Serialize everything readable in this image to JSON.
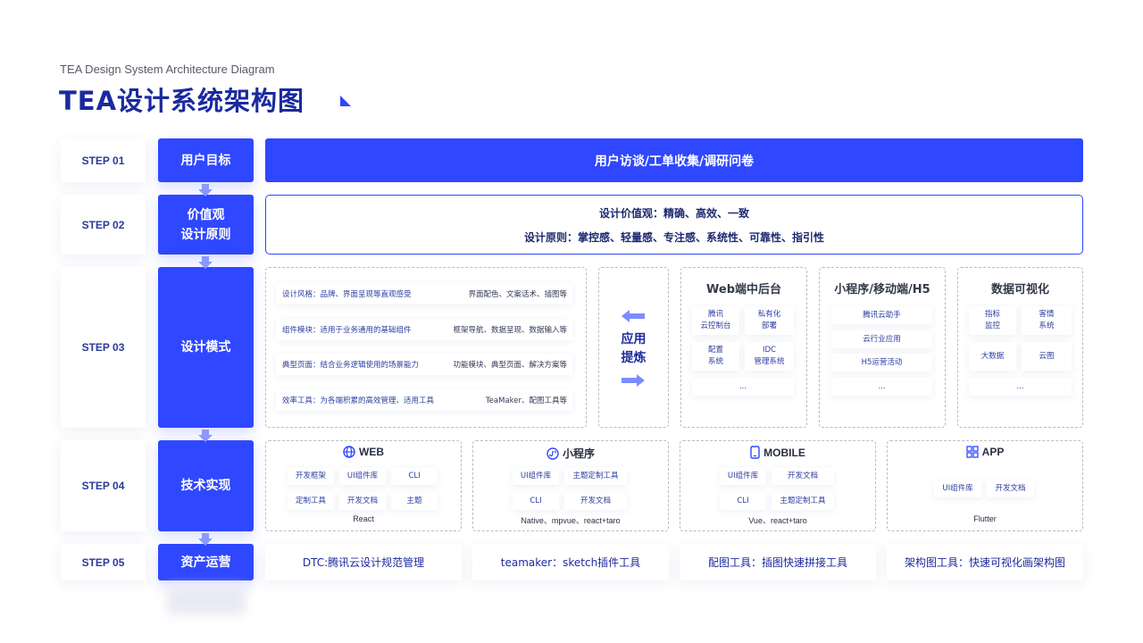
{
  "header": {
    "subtitle": "TEA Design System Architecture Diagram",
    "title": "TEA设计系统架构图"
  },
  "steps": [
    {
      "label": "STEP 01",
      "name": "用户目标"
    },
    {
      "label": "STEP 02",
      "name": "价值观\n设计原则",
      "name_line1": "价值观",
      "name_line2": "设计原则"
    },
    {
      "label": "STEP 03",
      "name": "设计模式"
    },
    {
      "label": "STEP 04",
      "name": "技术实现"
    },
    {
      "label": "STEP 05",
      "name": "资产运营"
    }
  ],
  "step01": {
    "banner": "用户访谈/工单收集/调研问卷"
  },
  "step02": {
    "values": "设计价值观：精确、高效、一致",
    "principles": "设计原则：掌控感、轻量感、专注感、系统性、可靠性、指引性"
  },
  "step03": {
    "rows": [
      {
        "left": "设计风格：品牌、界面呈现等直观感受",
        "right": "界面配色、文案话术、插图等"
      },
      {
        "left": "组件模块：适用于业务通用的基础组件",
        "right": "框架导航、数据呈现、数据输入等"
      },
      {
        "left": "典型页面：结合业务逻辑使用的场景能力",
        "right": "功能模块、典型页面、解决方案等"
      },
      {
        "left": "效率工具：为各端积累的高效管理、适用工具",
        "right": "TeaMaker、配图工具等"
      }
    ],
    "apply_line1": "应用",
    "apply_line2": "提炼",
    "web": {
      "title": "Web端中后台",
      "chips": [
        "腾讯\n云控制台",
        "私有化\n部署",
        "配置\n系统",
        "IDC\n管理系统",
        "..."
      ]
    },
    "mini": {
      "title": "小程序/移动端/H5",
      "chips": [
        "腾讯云助手",
        "云行业应用",
        "H5运营活动",
        "..."
      ]
    },
    "viz": {
      "title": "数据可视化",
      "chips": [
        "指标\n监控",
        "客情\n系统",
        "大数据",
        "云图",
        "..."
      ]
    }
  },
  "step04": {
    "web": {
      "title": "WEB",
      "icon": "globe-icon",
      "chips": [
        "开发框架",
        "UI组件库",
        "CLI",
        "定制工具",
        "开发文档",
        "主题"
      ],
      "foot": "React"
    },
    "mini": {
      "title": "小程序",
      "icon": "miniprogram-icon",
      "chips": [
        "UI组件库",
        "主题定制工具",
        "CLI",
        "开发文档"
      ],
      "foot": "Native、mpvue、react+taro"
    },
    "mobile": {
      "title": "MOBILE",
      "icon": "phone-icon",
      "chips": [
        "UI组件库",
        "开发文档",
        "CLI",
        "主题定制工具"
      ],
      "foot": "Vue、react+taro"
    },
    "app": {
      "title": "APP",
      "icon": "app-grid-icon",
      "chips": [
        "UI组件库",
        "开发文档"
      ],
      "foot": "Flutter"
    }
  },
  "step05": {
    "tools": [
      "DTC:腾讯云设计规范管理",
      "teamaker：sketch插件工具",
      "配图工具：插图快速拼接工具",
      "架构图工具：快速可视化画架构图"
    ]
  },
  "colors": {
    "primary": "#2f47ff",
    "title": "#1a2a9e",
    "text": "#2c3e9e"
  }
}
